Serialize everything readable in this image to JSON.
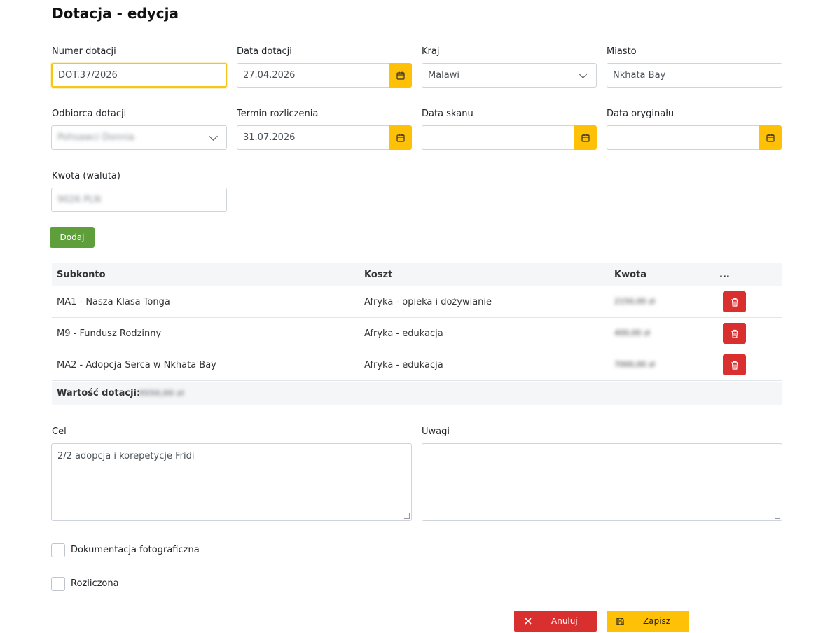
{
  "page": {
    "title": "Dotacja - edycja"
  },
  "form": {
    "numer_dotacji": {
      "label": "Numer dotacji",
      "value": "DOT.37/2026"
    },
    "data_dotacji": {
      "label": "Data dotacji",
      "value": "27.04.2026"
    },
    "kraj": {
      "label": "Kraj",
      "value": "Malawi"
    },
    "miasto": {
      "label": "Miasto",
      "value": "Nkhata Bay"
    },
    "odbiorca": {
      "label": "Odbiorca dotacji",
      "value": "Pohsawci Donnia"
    },
    "termin_rozliczenia": {
      "label": "Termin rozliczenia",
      "value": "31.07.2026"
    },
    "data_skanu": {
      "label": "Data skanu",
      "value": ""
    },
    "data_oryginalu": {
      "label": "Data oryginału",
      "value": ""
    },
    "kwota": {
      "label": "Kwota (waluta)",
      "value": "9026 PLN"
    }
  },
  "actions": {
    "add_label": "Dodaj",
    "cancel_label": "Anuluj",
    "save_label": "Zapisz"
  },
  "table": {
    "headers": {
      "subkonto": "Subkonto",
      "koszt": "Koszt",
      "kwota": "Kwota",
      "actions": "..."
    },
    "rows": [
      {
        "subkonto": "MA1 - Nasza Klasa Tonga",
        "koszt": "Afryka - opieka i dożywianie",
        "kwota": "2150,00 zł"
      },
      {
        "subkonto": "M9 - Fundusz Rodzinny",
        "koszt": "Afryka - edukacja",
        "kwota": "400,00 zł"
      },
      {
        "subkonto": "MA2 - Adopcja Serca w Nkhata Bay",
        "koszt": "Afryka - edukacja",
        "kwota": "7000,00 zł"
      }
    ],
    "summary": {
      "label": "Wartość dotacji:",
      "value": "9550,00 zł"
    }
  },
  "cel": {
    "label": "Cel",
    "value": "2/2 adopcja i korepetycje Fridi"
  },
  "uwagi": {
    "label": "Uwagi",
    "value": ""
  },
  "checkboxes": {
    "dokumentacja": {
      "label": "Dokumentacja fotograficzna",
      "checked": false
    },
    "rozliczona": {
      "label": "Rozliczona",
      "checked": false
    }
  },
  "colors": {
    "accent": "#ffc107",
    "success": "#5f9f3b",
    "danger": "#d9302f"
  }
}
